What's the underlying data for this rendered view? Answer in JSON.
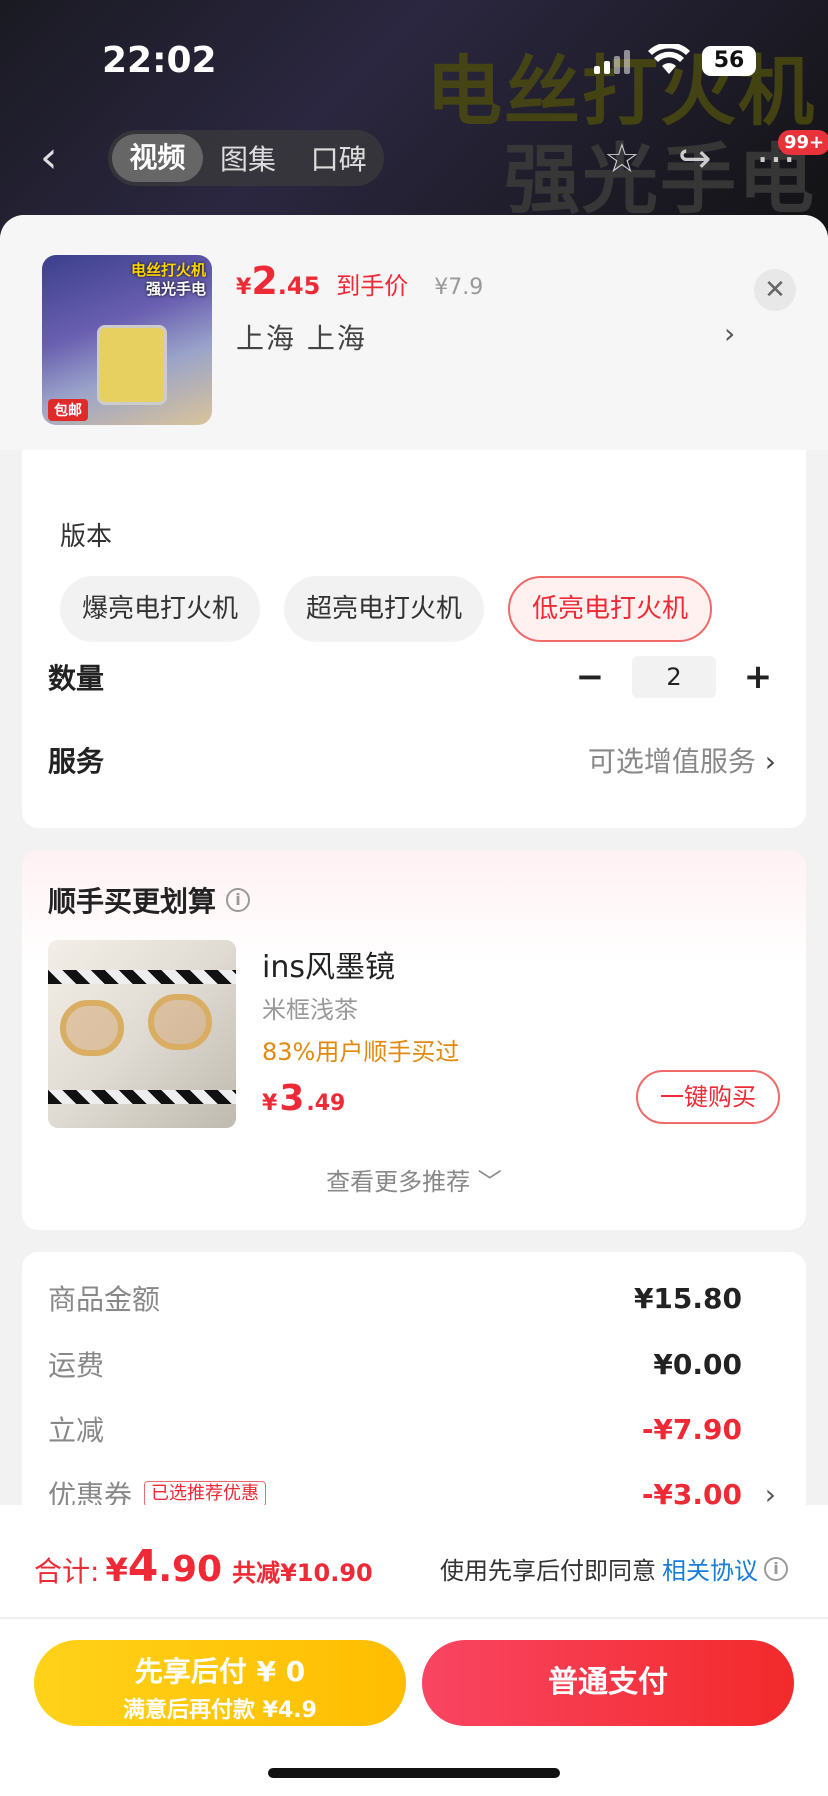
{
  "status_bar": {
    "time": "22:02",
    "battery": "56"
  },
  "background": {
    "title_line1": "电丝打火机",
    "title_line2": "强光手电"
  },
  "top_nav": {
    "tabs": [
      "视频",
      "图集",
      "口碑"
    ],
    "badge": "99+"
  },
  "product": {
    "thumb_text1": "电丝打火机",
    "thumb_text2": "强光手电",
    "thumb_tag": "包邮",
    "currency": "¥",
    "price_int": "2",
    "price_dec": ".45",
    "price_label": "到手价",
    "orig_price": "¥7.9",
    "location": "上海 上海"
  },
  "version": {
    "label": "版本",
    "options": [
      "爆亮电打火机",
      "超亮电打火机",
      "低亮电打火机"
    ],
    "selected": "低亮电打火机"
  },
  "quantity": {
    "label": "数量",
    "value": "2"
  },
  "service": {
    "label": "服务",
    "value": "可选增值服务"
  },
  "recommend": {
    "title": "顺手买更划算",
    "item_name": "ins风墨镜",
    "item_spec": "米框浅茶",
    "item_stat": "83%用户顺手买过",
    "price_cur": "¥",
    "price_int": "3",
    "price_dec": ".49",
    "buy_label": "一键购买",
    "more_label": "查看更多推荐 ﹀"
  },
  "summary": {
    "rows": [
      {
        "label": "商品金额",
        "value": "¥15.80"
      },
      {
        "label": "运费",
        "value": "¥0.00"
      },
      {
        "label": "立减",
        "value": "-¥7.90"
      },
      {
        "label": "优惠券",
        "value": "-¥3.00",
        "tag": "已选推荐优惠"
      }
    ]
  },
  "footer": {
    "total_label": "合计:",
    "total_cur": "¥",
    "total_int": "4",
    "total_dec": ".90",
    "total_saved": "共减¥10.90",
    "agree_text": "使用先享后付即同意",
    "agree_link": "相关协议",
    "pay_later_line1": "先享后付 ¥ 0",
    "pay_later_line2": "满意后再付款 ¥4.9",
    "pay_now": "普通支付"
  },
  "colors": {
    "accent": "#ee2a36",
    "pay_later": "#ffc400",
    "link": "#1a7cd9"
  }
}
